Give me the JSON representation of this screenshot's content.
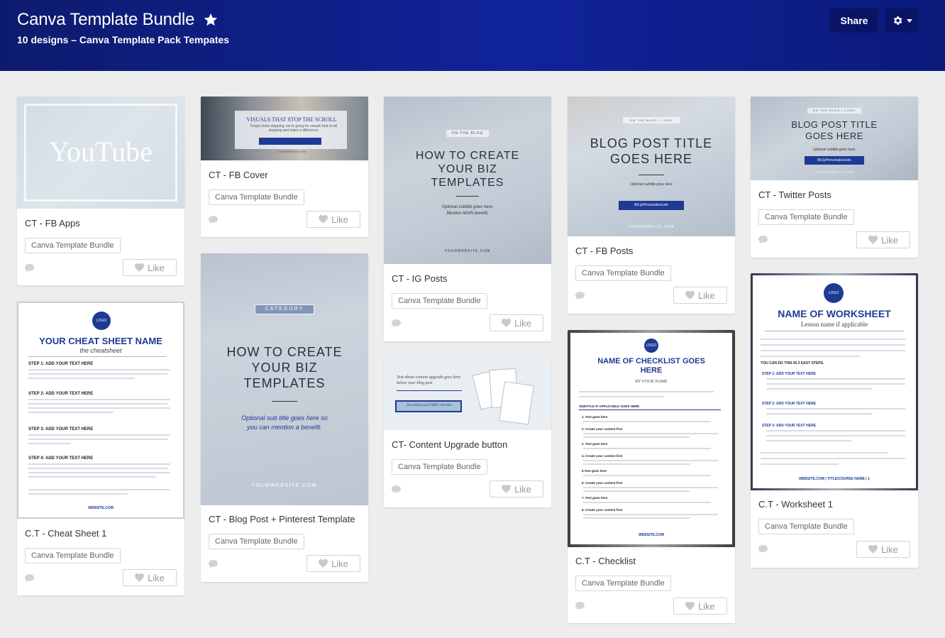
{
  "header": {
    "title": "Canva Template Bundle",
    "subtitle": "10 designs  –  Canva Template Pack Tempates",
    "share_label": "Share",
    "star_icon": "star-icon",
    "gear_icon": "gear-icon"
  },
  "tag_label": "Canva Template Bundle",
  "like_label": "Like",
  "cards": {
    "fb_apps": {
      "title": "CT - FB Apps",
      "thumb_text": "YouTube"
    },
    "fb_cover": {
      "title": "CT - FB Cover",
      "thumb_heading": "VISUALS THAT STOP THE SCROLL",
      "thumb_body": "Forget show stopping, we're going for visuals that scroll stopping and make a difference.",
      "thumb_link": "YOURWEBSITE.COM"
    },
    "ig_posts": {
      "title": "CT - IG Posts",
      "thumb_pill": "ON THE BLOG",
      "thumb_heading": "HOW TO CREATE YOUR BIZ TEMPLATES",
      "thumb_sub": "Optional subtitle goes here. Mention MAIN benefit.",
      "thumb_site": "YOURWEBSITE.COM"
    },
    "fb_posts": {
      "title": "CT - FB Posts",
      "thumb_pill": "ON THE BLOG | LOGO",
      "thumb_heading": "BLOG POST TITLE GOES HERE",
      "thumb_sub": "Optional subtitle goes here",
      "thumb_btn": "Bit.ly/PersonalizeLink",
      "thumb_site": "YOURWEBSITE.COM"
    },
    "twitter": {
      "title": "CT - Twitter Posts",
      "thumb_pill": "ON THE BLOG | LOGO",
      "thumb_heading": "BLOG POST TITLE GOES HERE",
      "thumb_sub": "Optional subtitle goes here.",
      "thumb_btn": "Bit.ly/PersonalizeLink",
      "thumb_site": "YOURWEBSITE.COM"
    },
    "cheat_sheet": {
      "title": "C.T - Cheat Sheet 1",
      "thumb_logo": "LOGO",
      "thumb_heading": "YOUR CHEAT SHEET NAME",
      "thumb_sub": "the cheatsheet",
      "steps": [
        "STEP 1: ADD YOUR TEXT HERE",
        "STEP 2: ADD YOUR TEXT HERE",
        "STEP 3: ADD YOUR TEXT HERE",
        "STEP 4: ADD YOUR TEXT HERE"
      ],
      "thumb_site": "WEBSITE.COM"
    },
    "blog_pinterest": {
      "title": "CT - Blog Post + Pinterest Template",
      "thumb_pill": "CATEGORY",
      "thumb_heading": "HOW TO CREATE YOUR BIZ TEMPLATES",
      "thumb_sub": "Optional sub title goes here so you can mention a benefit.",
      "thumb_site": "YOURWEBSITE.COM"
    },
    "content_upgrade": {
      "title": "CT- Content Upgrade button",
      "thumb_text": "Text about content upgrade goes here below your blog post",
      "thumb_btn": "Download your FREE checklist"
    },
    "checklist": {
      "title": "C.T - Checklist",
      "thumb_logo": "LOGO",
      "thumb_heading": "NAME OF CHECKLIST GOES HERE",
      "thumb_sub": "BY YOUR NAME",
      "thumb_section": "SUBTITLE IF APPLICABLE GOES HERE",
      "items": [
        "1. Text goes here",
        "2. Create your content first",
        "3. Text goes here",
        "4. Create your content first",
        "5.Text goes here",
        "6. Create your content first",
        "7. Text goes here",
        "8. Create your content first"
      ],
      "thumb_site": "WEBSITE.COM"
    },
    "worksheet": {
      "title": "C.T - Worksheet 1",
      "thumb_logo": "LOGO",
      "thumb_heading": "NAME OF WORKSHEET",
      "thumb_sub": "Lesson name if applicable",
      "steps_intro": "YOU CAN DO THIS IN 3 EASY STEPS.",
      "steps": [
        "STEP 1: ADD YOUR TEXT HERE",
        "STEP 2: ADD YOUR TEXT HERE",
        "STEP 3: ADD YOUR TEXT HERE"
      ],
      "thumb_site": "WEBSITE.COM | TITLE/COURSE NAME | 1"
    }
  },
  "colors": {
    "header_bg": "#10239a",
    "accent_blue": "#1e3a94",
    "page_bg": "#ededed"
  }
}
